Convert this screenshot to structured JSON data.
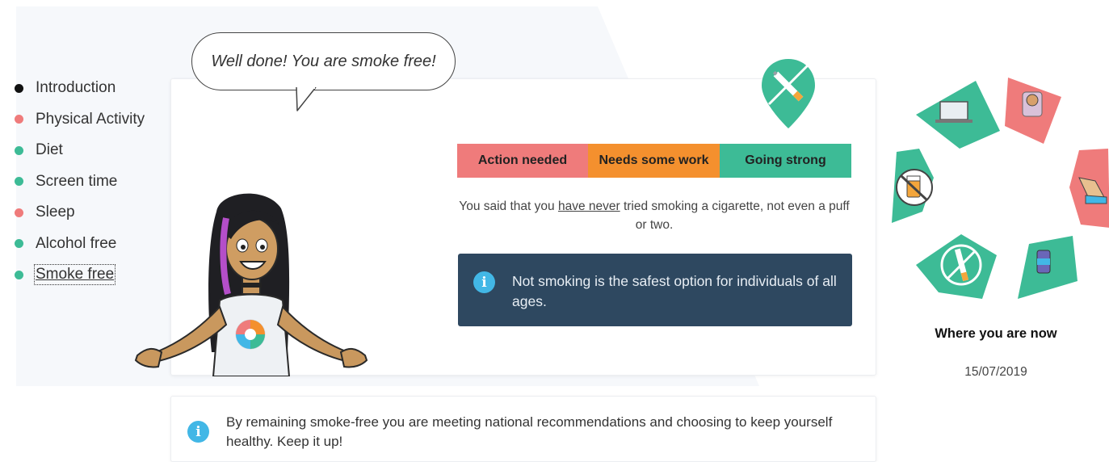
{
  "nav": {
    "items": [
      {
        "label": "Introduction",
        "color": "#111111"
      },
      {
        "label": "Physical Activity",
        "color": "#ef7b7b"
      },
      {
        "label": "Diet",
        "color": "#3dbb96"
      },
      {
        "label": "Screen time",
        "color": "#3dbb96"
      },
      {
        "label": "Sleep",
        "color": "#ef7b7b"
      },
      {
        "label": "Alcohol free",
        "color": "#3dbb96"
      },
      {
        "label": "Smoke free",
        "color": "#3dbb96"
      }
    ],
    "selected": "Smoke free"
  },
  "speech_bubble": "Well done! You are smoke free!",
  "status_bar": {
    "red": "Action needed",
    "orange": "Needs some work",
    "green": "Going strong",
    "current": "Going strong"
  },
  "answer": {
    "before": "You said that you ",
    "underlined": "have never",
    "after": " tried smoking a cigarette, not even a puff or two."
  },
  "info_box": {
    "icon": "info-icon",
    "text": "Not smoking is the safest option for individuals of all ages."
  },
  "bottom_info": {
    "icon": "info-icon",
    "text": "By remaining smoke-free you are meeting national recommendations and choosing to keep yourself healthy. Keep it up!"
  },
  "wheel": {
    "segments": [
      {
        "icon": "laptop-icon",
        "color": "#3dbb96"
      },
      {
        "icon": "sleeping-person-icon",
        "color": "#ef7b7b"
      },
      {
        "icon": "running-shoe-icon",
        "color": "#ef7b7b"
      },
      {
        "icon": "food-can-icon",
        "color": "#3dbb96"
      },
      {
        "icon": "no-smoking-icon",
        "color": "#3dbb96"
      },
      {
        "icon": "no-alcohol-icon",
        "color": "#3dbb96"
      }
    ],
    "label": "Where you are now",
    "date": "15/07/2019"
  },
  "info_glyph": "i",
  "colors": {
    "red": "#ef7b7b",
    "orange": "#f4902e",
    "green": "#3dbb96",
    "info_dark": "#2e4860",
    "info_blue": "#42b7e6"
  }
}
